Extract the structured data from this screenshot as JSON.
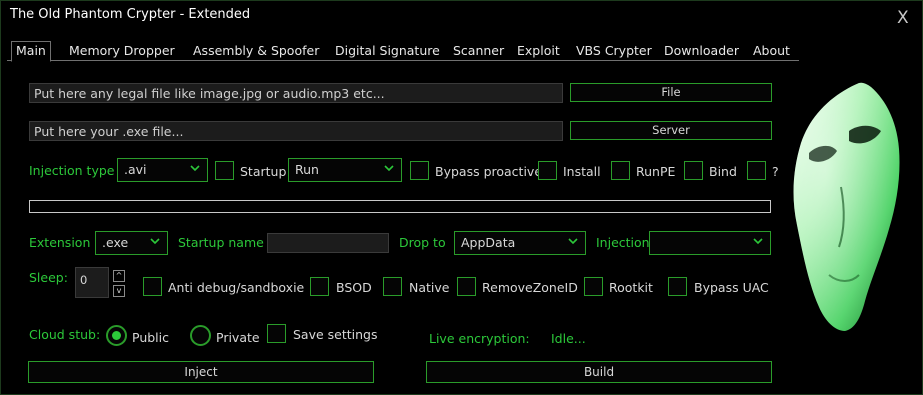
{
  "window": {
    "title": "The Old Phantom Crypter - Extended",
    "close_glyph": "X"
  },
  "tabs": [
    "Main",
    "Memory Dropper",
    "Assembly & Spoofer",
    "Digital Signature",
    "Scanner",
    "Exploit",
    "VBS Crypter",
    "Downloader",
    "About"
  ],
  "active_tab": "Main",
  "file_row": {
    "placeholder": "Put here any legal file like image.jpg or audio.mp3 etc...",
    "button": "File"
  },
  "server_row": {
    "placeholder": "Put here your .exe file...",
    "button": "Server"
  },
  "injection_row": {
    "injection_type_label": "Injection type",
    "injection_type_value": ".avi",
    "startup_label": "Startup",
    "startup_checked": false,
    "startup_method_value": "Run",
    "bypass_proactive_label": "Bypass proactive",
    "bypass_proactive_checked": false,
    "install_label": "Install",
    "install_checked": false,
    "runpe_label": "RunPE",
    "runpe_checked": false,
    "bind_label": "Bind",
    "bind_checked": false,
    "help_label": "?",
    "help_checked": false
  },
  "progress": {
    "fraction": 0
  },
  "drop_row": {
    "extension_label": "Extension",
    "extension_value": ".exe",
    "startup_name_label": "Startup name",
    "startup_name_value": "",
    "drop_to_label": "Drop to",
    "drop_to_value": "AppData",
    "injection_label": "Injection",
    "injection_value": ""
  },
  "options_row": {
    "sleep_label": "Sleep:",
    "sleep_value": "0",
    "spin_up": "^",
    "spin_down": "v",
    "anti_debug_label": "Anti debug/sandboxie",
    "bsod_label": "BSOD",
    "native_label": "Native",
    "remove_zone_label": "RemoveZoneID",
    "rootkit_label": "Rootkit",
    "bypass_uac_label": "Bypass UAC"
  },
  "stub_row": {
    "cloud_stub_label": "Cloud stub:",
    "public_label": "Public",
    "private_label": "Private",
    "selected": "Public",
    "save_settings_label": "Save settings",
    "live_encryption_label": "Live encryption:",
    "live_encryption_status": "Idle..."
  },
  "actions": {
    "inject": "Inject",
    "build": "Build"
  },
  "colors": {
    "accent": "#2cc83a",
    "border": "#2a9c2a",
    "background": "#000000"
  }
}
